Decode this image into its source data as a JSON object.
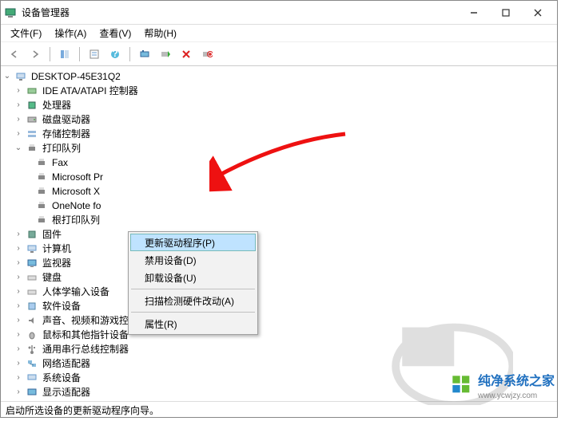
{
  "window": {
    "title": "设备管理器"
  },
  "menu": {
    "file": "文件(F)",
    "action": "操作(A)",
    "view": "查看(V)",
    "help": "帮助(H)"
  },
  "tree": {
    "root": "DESKTOP-45E31Q2",
    "ide": "IDE ATA/ATAPI 控制器",
    "cpu": "处理器",
    "disk": "磁盘驱动器",
    "storage": "存储控制器",
    "printq": "打印队列",
    "fax": "Fax",
    "msprint": "Microsoft Pr",
    "msxps": "Microsoft X",
    "onenote": "OneNote fo",
    "rootprint": "根打印队列",
    "firmware": "固件",
    "computer": "计算机",
    "monitor": "监视器",
    "keyboard": "键盘",
    "hid": "人体学输入设备",
    "software": "软件设备",
    "audio": "声音、视频和游戏控制器",
    "mouse": "鼠标和其他指针设备",
    "usb": "通用串行总线控制器",
    "net": "网络适配器",
    "system": "系统设备",
    "display": "显示适配器"
  },
  "context": {
    "update": "更新驱动程序(P)",
    "disable": "禁用设备(D)",
    "uninstall": "卸载设备(U)",
    "scan": "扫描检测硬件改动(A)",
    "properties": "属性(R)"
  },
  "status": "启动所选设备的更新驱动程序向导。",
  "watermark": {
    "text": "纯净系统之家",
    "url": "www.ycwjzy.com"
  }
}
